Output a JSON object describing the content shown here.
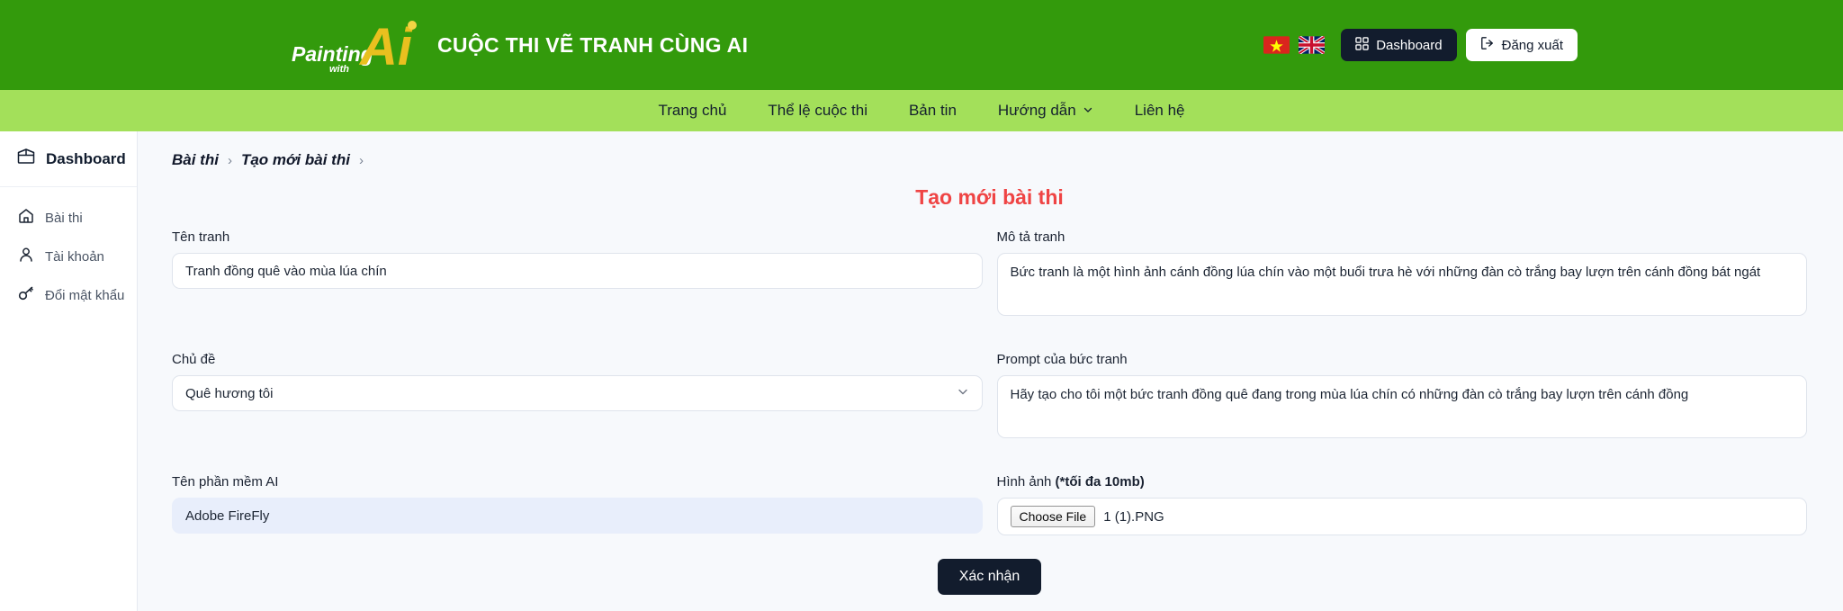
{
  "header": {
    "logo": {
      "word_top": "Painting",
      "word_mid": "with",
      "word_ai": "Ai",
      "alt": "painting-with-ai-logo"
    },
    "site_title": "CUỘC THI VẼ TRANH CÙNG AI",
    "lang_vi": "vietnam-flag",
    "lang_en": "uk-flag",
    "dashboard_button": "Dashboard",
    "logout_button": "Đăng xuất",
    "colors": {
      "header_bg": "#339a0c",
      "nav_bg": "#a3e05a",
      "dark_button": "#121c2d",
      "title_red": "#ef4444"
    }
  },
  "nav": {
    "items": [
      {
        "label": "Trang chủ",
        "has_chevron": false
      },
      {
        "label": "Thể lệ cuộc thi",
        "has_chevron": false
      },
      {
        "label": "Bản tin",
        "has_chevron": false
      },
      {
        "label": "Hướng dẫn",
        "has_chevron": true
      },
      {
        "label": "Liên hệ",
        "has_chevron": false
      }
    ]
  },
  "sidebar": {
    "header_label": "Dashboard",
    "items": [
      {
        "label": "Bài thi",
        "icon": "home-icon"
      },
      {
        "label": "Tài khoản",
        "icon": "user-icon"
      },
      {
        "label": "Đổi mật khẩu",
        "icon": "key-icon"
      }
    ]
  },
  "breadcrumb": {
    "item1": "Bài thi",
    "sep1": "›",
    "item2": "Tạo mới bài thi",
    "sep2": "›"
  },
  "page_title": "Tạo mới bài thi",
  "form": {
    "ten_tranh": {
      "label": "Tên tranh",
      "value": "Tranh đồng quê vào mùa lúa chín"
    },
    "mo_ta_tranh": {
      "label": "Mô tả tranh",
      "value": "Bức tranh là một hình ảnh cánh đồng lúa chín vào một buổi trưa hè với những đàn cò trắng bay lượn trên cánh đồng bát ngát"
    },
    "chu_de": {
      "label": "Chủ đề",
      "value": "Quê hương tôi"
    },
    "prompt": {
      "label": "Prompt của bức tranh",
      "value": "Hãy tạo cho tôi một bức tranh đồng quê đang trong mùa lúa chín có những đàn cò trắng bay lượn trên cánh đồng"
    },
    "ten_phan_mem": {
      "label": "Tên phần mềm AI",
      "value": "Adobe FireFly"
    },
    "hinh_anh": {
      "label_main": "Hình ảnh ",
      "label_bold": "(*tối đa 10mb)",
      "choose_file_button": "Choose File",
      "file_name": "1 (1).PNG"
    },
    "submit_button": "Xác nhận"
  }
}
